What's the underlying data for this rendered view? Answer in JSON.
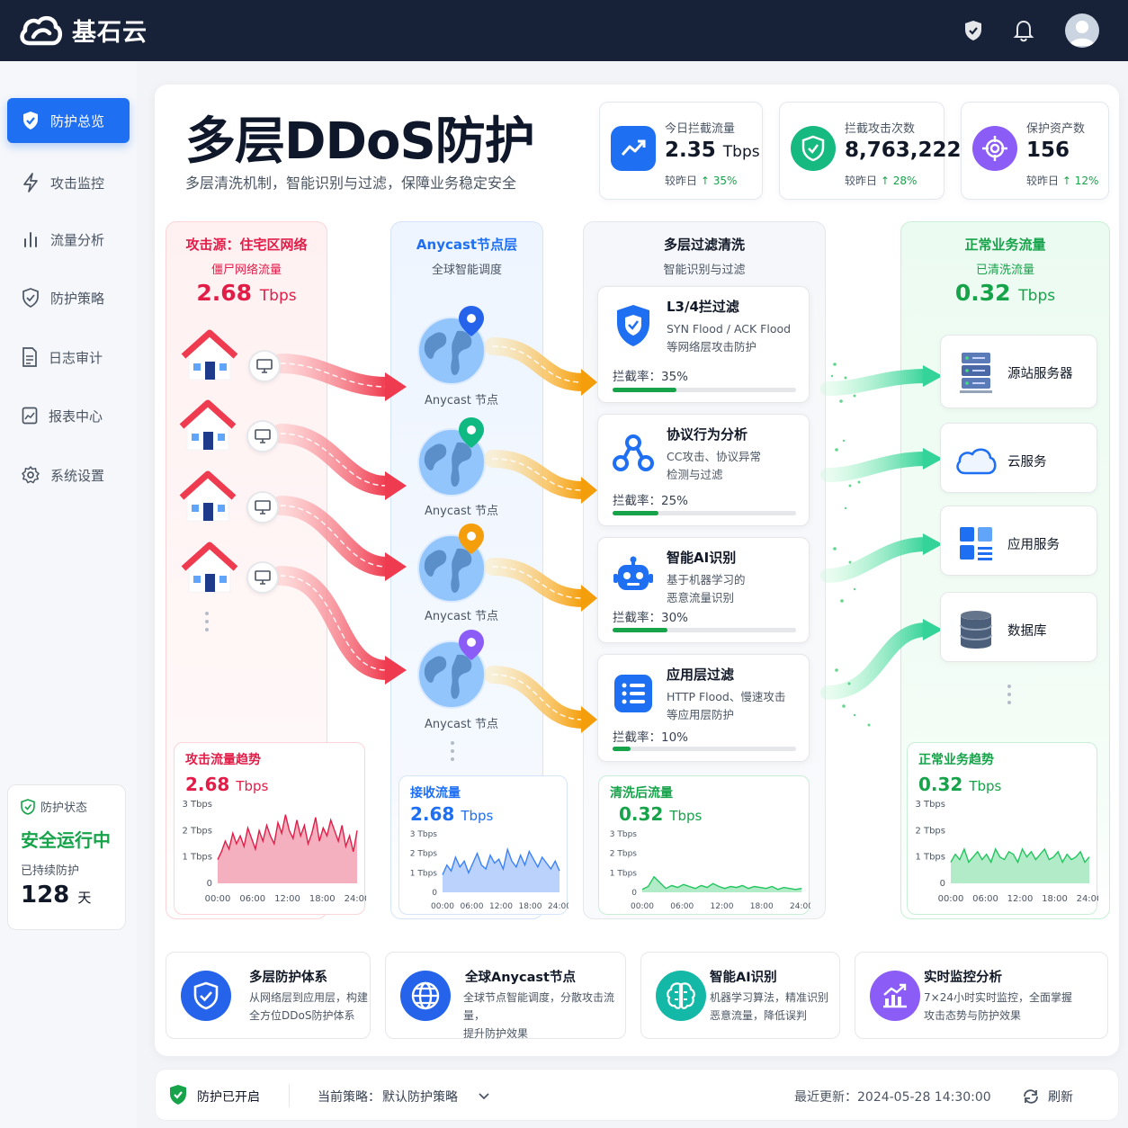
{
  "app": {
    "name": "基石云"
  },
  "nav": {
    "items": [
      {
        "label": "防护总览",
        "icon": "shield-icon",
        "active": true
      },
      {
        "label": "攻击监控",
        "icon": "lightning-icon"
      },
      {
        "label": "流量分析",
        "icon": "bar-chart-icon"
      },
      {
        "label": "防护策略",
        "icon": "shield-check-icon"
      },
      {
        "label": "日志审计",
        "icon": "document-icon"
      },
      {
        "label": "报表中心",
        "icon": "report-icon"
      },
      {
        "label": "系统设置",
        "icon": "gear-icon"
      }
    ]
  },
  "status_card": {
    "title": "防护状态",
    "state": "安全运行中",
    "duration_label": "已持续防护",
    "days": "128",
    "days_unit": "天"
  },
  "hero": {
    "title": "多层DDoS防护",
    "subtitle": "多层清洗机制，智能识别与过滤，保障业务稳定安全"
  },
  "kpis": [
    {
      "label": "今日拦截流量",
      "value": "2.35",
      "unit": "Tbps",
      "compare": "较昨日",
      "change": "↑ 35%",
      "icon": "trend-up-icon",
      "color": "#1e6ff2"
    },
    {
      "label": "拦截攻击次数",
      "value": "8,763,222",
      "unit": "",
      "compare": "较昨日",
      "change": "↑ 28%",
      "icon": "shield-check-icon",
      "color": "#16b980"
    },
    {
      "label": "保护资产数",
      "value": "156",
      "unit": "",
      "compare": "较昨日",
      "change": "↑ 12%",
      "icon": "target-icon",
      "color": "#8b5cf6"
    }
  ],
  "attack_col": {
    "title": "攻击源：住宅区网络",
    "subtitle": "僵尸网络流量",
    "value": "2.68",
    "unit": "Tbps"
  },
  "anycast_col": {
    "title": "Anycast节点层",
    "subtitle": "全球智能调度",
    "node_label": "Anycast 节点"
  },
  "filter_col": {
    "title": "多层过滤清洗",
    "subtitle": "智能识别与过滤"
  },
  "filters": [
    {
      "title": "L3/4拦过滤",
      "desc1": "SYN Flood / ACK Flood",
      "desc2": "等网络层攻击防护",
      "rate_label": "拦截率：35%",
      "rate": 0.35
    },
    {
      "title": "协议行为分析",
      "desc1": "CC攻击、协议异常",
      "desc2": "检测与过滤",
      "rate_label": "拦截率：25%",
      "rate": 0.25
    },
    {
      "title": "智能AI识别",
      "desc1": "基于机器学习的",
      "desc2": "恶意流量识别",
      "rate_label": "拦截率：30%",
      "rate": 0.3
    },
    {
      "title": "应用层过滤",
      "desc1": "HTTP Flood、慢速攻击",
      "desc2": "等应用层防护",
      "rate_label": "拦截率：10%",
      "rate": 0.1
    }
  ],
  "normal_col": {
    "title": "正常业务流量",
    "subtitle": "已清洗流量",
    "value": "0.32",
    "unit": "Tbps"
  },
  "services": [
    {
      "label": "源站服务器",
      "icon": "server-icon"
    },
    {
      "label": "云服务",
      "icon": "cloud-icon"
    },
    {
      "label": "应用服务",
      "icon": "app-grid-icon"
    },
    {
      "label": "数据库",
      "icon": "database-icon"
    }
  ],
  "trends": [
    {
      "title": "攻击流量趋势",
      "value": "2.68",
      "unit": "Tbps",
      "color": "#e11d48",
      "y_ticks": [
        "3 Tbps",
        "2 Tbps",
        "1 Tbps",
        "0"
      ],
      "x_ticks": [
        "00:00",
        "06:00",
        "12:00",
        "18:00",
        "24:00"
      ],
      "series": [
        0.9,
        1.2,
        1.6,
        1.3,
        1.9,
        1.5,
        1.8,
        1.4,
        2.1,
        1.7,
        1.3,
        2.0,
        1.6,
        2.2,
        1.8,
        1.5,
        2.3,
        1.9,
        2.6,
        2.0,
        1.7,
        2.4,
        1.8,
        2.2,
        1.5,
        1.9,
        2.5,
        1.6,
        2.1,
        1.8,
        2.4,
        2.0,
        1.6,
        2.2,
        1.4,
        1.8,
        1.2,
        2.0
      ]
    },
    {
      "title": "接收流量",
      "value": "2.68",
      "unit": "Tbps",
      "color": "#3b82f6",
      "y_ticks": [
        "3 Tbps",
        "2 Tbps",
        "1 Tbps",
        "0"
      ],
      "x_ticks": [
        "00:00",
        "06:00",
        "12:00",
        "18:00",
        "24:00"
      ],
      "series": [
        0.9,
        1.4,
        1.1,
        1.8,
        1.3,
        1.6,
        1.0,
        1.5,
        2.0,
        1.4,
        1.2,
        1.9,
        1.5,
        1.7,
        1.2,
        2.2,
        1.6,
        1.3,
        1.9,
        1.4,
        2.1,
        1.7,
        1.3,
        1.8,
        1.5,
        1.2,
        1.6,
        1.1
      ]
    },
    {
      "title": "清洗后流量",
      "value": "0.32",
      "unit": "Tbps",
      "color": "#22c55e",
      "y_ticks": [
        "3 Tbps",
        "2 Tbps",
        "1 Tbps",
        "0"
      ],
      "x_ticks": [
        "00:00",
        "06:00",
        "12:00",
        "18:00",
        "24:00"
      ],
      "series": [
        0.15,
        0.3,
        0.8,
        0.5,
        0.2,
        0.35,
        0.25,
        0.4,
        0.3,
        0.2,
        0.35,
        0.25,
        0.45,
        0.3,
        0.2,
        0.3,
        0.25,
        0.35,
        0.2,
        0.3,
        0.25,
        0.2,
        0.3,
        0.15,
        0.25,
        0.2,
        0.15,
        0.2
      ]
    },
    {
      "title": "正常业务趋势",
      "value": "0.32",
      "unit": "Tbps",
      "color": "#22c55e",
      "y_ticks": [
        "3 Tbps",
        "2 Tbps",
        "1 Tbps",
        "0"
      ],
      "x_ticks": [
        "00:00",
        "06:00",
        "12:00",
        "18:00",
        "24:00"
      ],
      "series": [
        0.8,
        1.1,
        0.9,
        1.3,
        0.8,
        1.0,
        1.2,
        0.9,
        1.1,
        0.8,
        1.3,
        1.0,
        0.9,
        1.2,
        1.1,
        0.8,
        1.3,
        1.0,
        1.2,
        0.9,
        1.1,
        1.3,
        0.9,
        1.0,
        1.2,
        0.8,
        1.1,
        0.9,
        1.0,
        1.2,
        0.8,
        1.0
      ]
    }
  ],
  "features": [
    {
      "title": "多层防护体系",
      "desc1": "从网络层到应用层，构建",
      "desc2": "全方位DDoS防护体系",
      "icon": "shield-check-icon",
      "color": "#2563eb"
    },
    {
      "title": "全球Anycast节点",
      "desc1": "全球节点智能调度，分散攻击流量，",
      "desc2": "提升防护效果",
      "icon": "globe-icon",
      "color": "#2563eb"
    },
    {
      "title": "智能AI识别",
      "desc1": "机器学习算法，精准识别",
      "desc2": "恶意流量，降低误判",
      "icon": "ai-brain-icon",
      "color": "#14b8a6"
    },
    {
      "title": "实时监控分析",
      "desc1": "7×24小时实时监控，全面掌握",
      "desc2": "攻击态势与防护效果",
      "icon": "monitor-chart-icon",
      "color": "#8b5cf6"
    }
  ],
  "footer": {
    "protect_status": "防护已开启",
    "policy_label": "当前策略：",
    "policy_value": "默认防护策略",
    "updated_label": "最近更新：",
    "updated_value": "2024-05-28 14:30:00",
    "refresh": "刷新"
  }
}
